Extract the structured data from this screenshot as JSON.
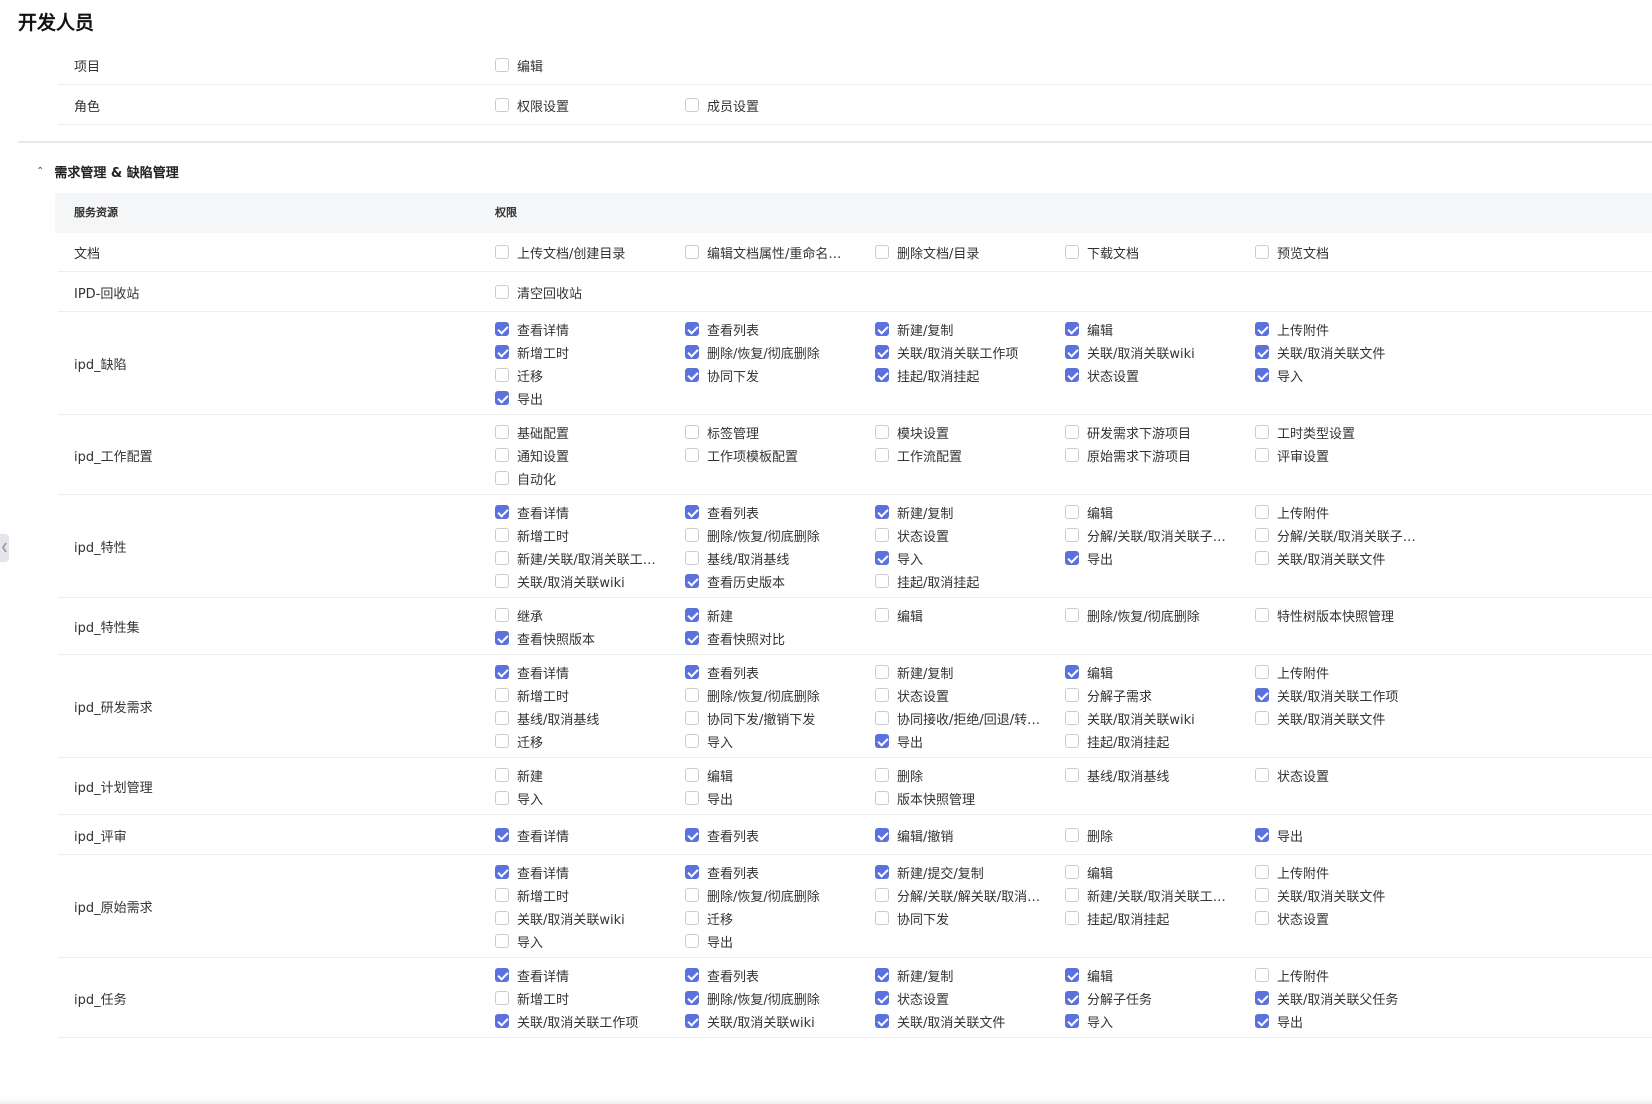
{
  "page_title": "开发人员",
  "section": {
    "title": "需求管理 & 缺陷管理"
  },
  "table_headers": {
    "resource": "服务资源",
    "permissions": "权限"
  },
  "top_rows": [
    {
      "name": "项目",
      "items": [
        {
          "label": "编辑",
          "checked": false
        }
      ]
    },
    {
      "name": "角色",
      "items": [
        {
          "label": "权限设置",
          "checked": false
        },
        {
          "label": "成员设置",
          "checked": false
        }
      ]
    }
  ],
  "rows": [
    {
      "name": "文档",
      "items": [
        {
          "label": "上传文档/创建目录",
          "checked": false
        },
        {
          "label": "编辑文档属性/重命名…",
          "checked": false
        },
        {
          "label": "删除文档/目录",
          "checked": false
        },
        {
          "label": "下载文档",
          "checked": false
        },
        {
          "label": "预览文档",
          "checked": false
        }
      ]
    },
    {
      "name": "IPD-回收站",
      "items": [
        {
          "label": "清空回收站",
          "checked": false
        }
      ]
    },
    {
      "name": "ipd_缺陷",
      "items": [
        {
          "label": "查看详情",
          "checked": true
        },
        {
          "label": "查看列表",
          "checked": true
        },
        {
          "label": "新建/复制",
          "checked": true
        },
        {
          "label": "编辑",
          "checked": true
        },
        {
          "label": "上传附件",
          "checked": true
        },
        {
          "label": "新增工时",
          "checked": true
        },
        {
          "label": "删除/恢复/彻底删除",
          "checked": true
        },
        {
          "label": "关联/取消关联工作项",
          "checked": true
        },
        {
          "label": "关联/取消关联wiki",
          "checked": true
        },
        {
          "label": "关联/取消关联文件",
          "checked": true
        },
        {
          "label": "迁移",
          "checked": false
        },
        {
          "label": "协同下发",
          "checked": true
        },
        {
          "label": "挂起/取消挂起",
          "checked": true
        },
        {
          "label": "状态设置",
          "checked": true
        },
        {
          "label": "导入",
          "checked": true
        },
        {
          "label": "导出",
          "checked": true
        }
      ]
    },
    {
      "name": "ipd_工作配置",
      "items": [
        {
          "label": "基础配置",
          "checked": false
        },
        {
          "label": "标签管理",
          "checked": false
        },
        {
          "label": "模块设置",
          "checked": false
        },
        {
          "label": "研发需求下游项目",
          "checked": false
        },
        {
          "label": "工时类型设置",
          "checked": false
        },
        {
          "label": "通知设置",
          "checked": false
        },
        {
          "label": "工作项模板配置",
          "checked": false
        },
        {
          "label": "工作流配置",
          "checked": false
        },
        {
          "label": "原始需求下游项目",
          "checked": false
        },
        {
          "label": "评审设置",
          "checked": false
        },
        {
          "label": "自动化",
          "checked": false
        }
      ]
    },
    {
      "name": "ipd_特性",
      "items": [
        {
          "label": "查看详情",
          "checked": true
        },
        {
          "label": "查看列表",
          "checked": true
        },
        {
          "label": "新建/复制",
          "checked": true
        },
        {
          "label": "编辑",
          "checked": false
        },
        {
          "label": "上传附件",
          "checked": false
        },
        {
          "label": "新增工时",
          "checked": false
        },
        {
          "label": "删除/恢复/彻底删除",
          "checked": false
        },
        {
          "label": "状态设置",
          "checked": false
        },
        {
          "label": "分解/关联/取消关联子…",
          "checked": false
        },
        {
          "label": "分解/关联/取消关联子…",
          "checked": false
        },
        {
          "label": "新建/关联/取消关联工…",
          "checked": false
        },
        {
          "label": "基线/取消基线",
          "checked": false
        },
        {
          "label": "导入",
          "checked": true
        },
        {
          "label": "导出",
          "checked": true
        },
        {
          "label": "关联/取消关联文件",
          "checked": false
        },
        {
          "label": "关联/取消关联wiki",
          "checked": false
        },
        {
          "label": "查看历史版本",
          "checked": true
        },
        {
          "label": "挂起/取消挂起",
          "checked": false
        }
      ]
    },
    {
      "name": "ipd_特性集",
      "items": [
        {
          "label": "继承",
          "checked": false
        },
        {
          "label": "新建",
          "checked": true
        },
        {
          "label": "编辑",
          "checked": false
        },
        {
          "label": "删除/恢复/彻底删除",
          "checked": false
        },
        {
          "label": "特性树版本快照管理",
          "checked": false
        },
        {
          "label": "查看快照版本",
          "checked": true
        },
        {
          "label": "查看快照对比",
          "checked": true
        }
      ]
    },
    {
      "name": "ipd_研发需求",
      "items": [
        {
          "label": "查看详情",
          "checked": true
        },
        {
          "label": "查看列表",
          "checked": true
        },
        {
          "label": "新建/复制",
          "checked": false
        },
        {
          "label": "编辑",
          "checked": true
        },
        {
          "label": "上传附件",
          "checked": false
        },
        {
          "label": "新增工时",
          "checked": false
        },
        {
          "label": "删除/恢复/彻底删除",
          "checked": false
        },
        {
          "label": "状态设置",
          "checked": false
        },
        {
          "label": "分解子需求",
          "checked": false
        },
        {
          "label": "关联/取消关联工作项",
          "checked": true
        },
        {
          "label": "基线/取消基线",
          "checked": false
        },
        {
          "label": "协同下发/撤销下发",
          "checked": false
        },
        {
          "label": "协同接收/拒绝/回退/转…",
          "checked": false
        },
        {
          "label": "关联/取消关联wiki",
          "checked": false
        },
        {
          "label": "关联/取消关联文件",
          "checked": false
        },
        {
          "label": "迁移",
          "checked": false
        },
        {
          "label": "导入",
          "checked": false
        },
        {
          "label": "导出",
          "checked": true
        },
        {
          "label": "挂起/取消挂起",
          "checked": false
        }
      ]
    },
    {
      "name": "ipd_计划管理",
      "items": [
        {
          "label": "新建",
          "checked": false
        },
        {
          "label": "编辑",
          "checked": false
        },
        {
          "label": "删除",
          "checked": false
        },
        {
          "label": "基线/取消基线",
          "checked": false
        },
        {
          "label": "状态设置",
          "checked": false
        },
        {
          "label": "导入",
          "checked": false
        },
        {
          "label": "导出",
          "checked": false
        },
        {
          "label": "版本快照管理",
          "checked": false
        }
      ]
    },
    {
      "name": "ipd_评审",
      "items": [
        {
          "label": "查看详情",
          "checked": true
        },
        {
          "label": "查看列表",
          "checked": true
        },
        {
          "label": "编辑/撤销",
          "checked": true
        },
        {
          "label": "删除",
          "checked": false
        },
        {
          "label": "导出",
          "checked": true
        }
      ]
    },
    {
      "name": "ipd_原始需求",
      "items": [
        {
          "label": "查看详情",
          "checked": true
        },
        {
          "label": "查看列表",
          "checked": true
        },
        {
          "label": "新建/提交/复制",
          "checked": true
        },
        {
          "label": "编辑",
          "checked": false
        },
        {
          "label": "上传附件",
          "checked": false
        },
        {
          "label": "新增工时",
          "checked": false
        },
        {
          "label": "删除/恢复/彻底删除",
          "checked": false
        },
        {
          "label": "分解/关联/解关联/取消…",
          "checked": false
        },
        {
          "label": "新建/关联/取消关联工…",
          "checked": false
        },
        {
          "label": "关联/取消关联文件",
          "checked": false
        },
        {
          "label": "关联/取消关联wiki",
          "checked": false
        },
        {
          "label": "迁移",
          "checked": false
        },
        {
          "label": "协同下发",
          "checked": false
        },
        {
          "label": "挂起/取消挂起",
          "checked": false
        },
        {
          "label": "状态设置",
          "checked": false
        },
        {
          "label": "导入",
          "checked": false
        },
        {
          "label": "导出",
          "checked": false
        }
      ]
    },
    {
      "name": "ipd_任务",
      "items": [
        {
          "label": "查看详情",
          "checked": true
        },
        {
          "label": "查看列表",
          "checked": true
        },
        {
          "label": "新建/复制",
          "checked": true
        },
        {
          "label": "编辑",
          "checked": true
        },
        {
          "label": "上传附件",
          "checked": false
        },
        {
          "label": "新增工时",
          "checked": false
        },
        {
          "label": "删除/恢复/彻底删除",
          "checked": true
        },
        {
          "label": "状态设置",
          "checked": true
        },
        {
          "label": "分解子任务",
          "checked": true
        },
        {
          "label": "关联/取消关联父任务",
          "checked": true
        },
        {
          "label": "关联/取消关联工作项",
          "checked": true
        },
        {
          "label": "关联/取消关联wiki",
          "checked": true
        },
        {
          "label": "关联/取消关联文件",
          "checked": true
        },
        {
          "label": "导入",
          "checked": true
        },
        {
          "label": "导出",
          "checked": true
        }
      ]
    }
  ]
}
